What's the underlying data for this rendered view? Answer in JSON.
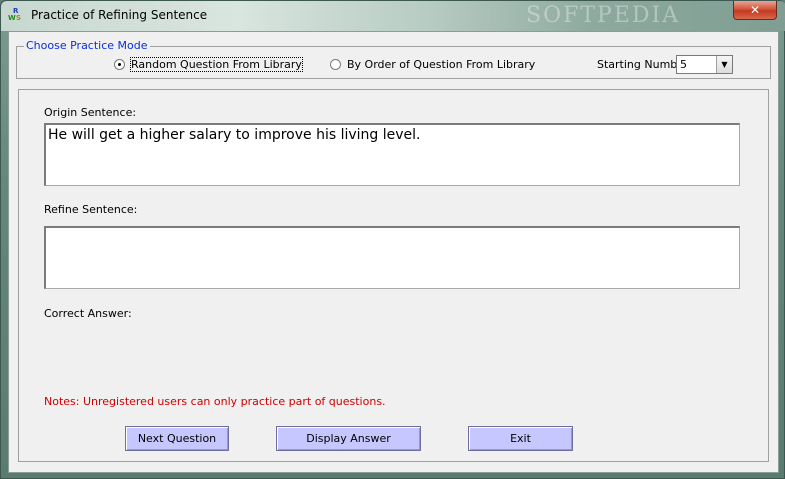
{
  "window": {
    "title": "Practice of Refining Sentence",
    "watermark": "SOFTPEDIA",
    "close_label": "✕"
  },
  "icon": {
    "l1": "R",
    "l2": "W",
    "l3": "S"
  },
  "mode": {
    "legend": "Choose Practice Mode",
    "option_random": "Random Question From Library",
    "option_order": "By Order of Question From Library",
    "selected": "random",
    "starting_number_label": "Starting Number:",
    "starting_number_value": "5"
  },
  "fields": {
    "origin_label": "Origin Sentence:",
    "origin_value": "He will get a higher salary to improve his living level.",
    "refine_label": "Refine Sentence:",
    "refine_value": "",
    "correct_label": "Correct Answer:",
    "correct_value": ""
  },
  "note": "Notes: Unregistered users can only practice part of questions.",
  "buttons": {
    "next": "Next Question",
    "display": "Display Answer",
    "exit": "Exit"
  },
  "colors": {
    "legend": "#0a2fd6",
    "note": "#d00000",
    "button_bg": "#c7c7ff",
    "close_button": "#c23a20"
  }
}
